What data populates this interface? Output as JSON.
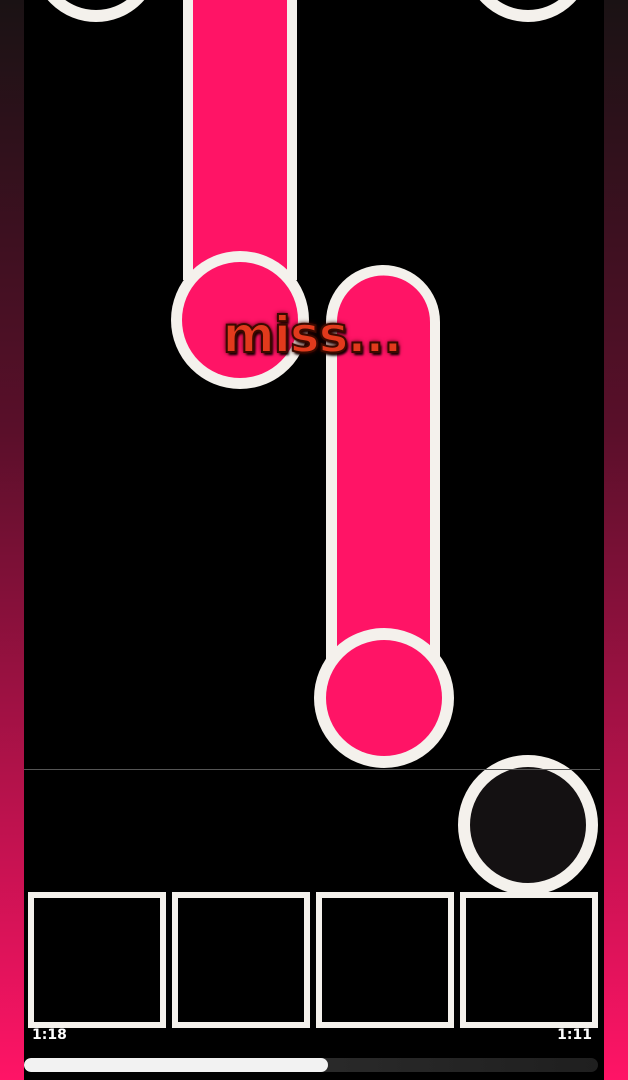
{
  "game": {
    "judgement": "miss...",
    "time_elapsed": "1:18",
    "time_remaining": "1:11",
    "progress": 0.53,
    "lanes": 4
  },
  "colors": {
    "note_fill": "#ff1466",
    "note_outline": "#f4f1ec",
    "background": "#000000",
    "side_gradient_top": "#1a1214",
    "side_gradient_bottom": "#ff1466",
    "judgement_text": "#e23a1c",
    "tap_target_fill": "#141112"
  }
}
